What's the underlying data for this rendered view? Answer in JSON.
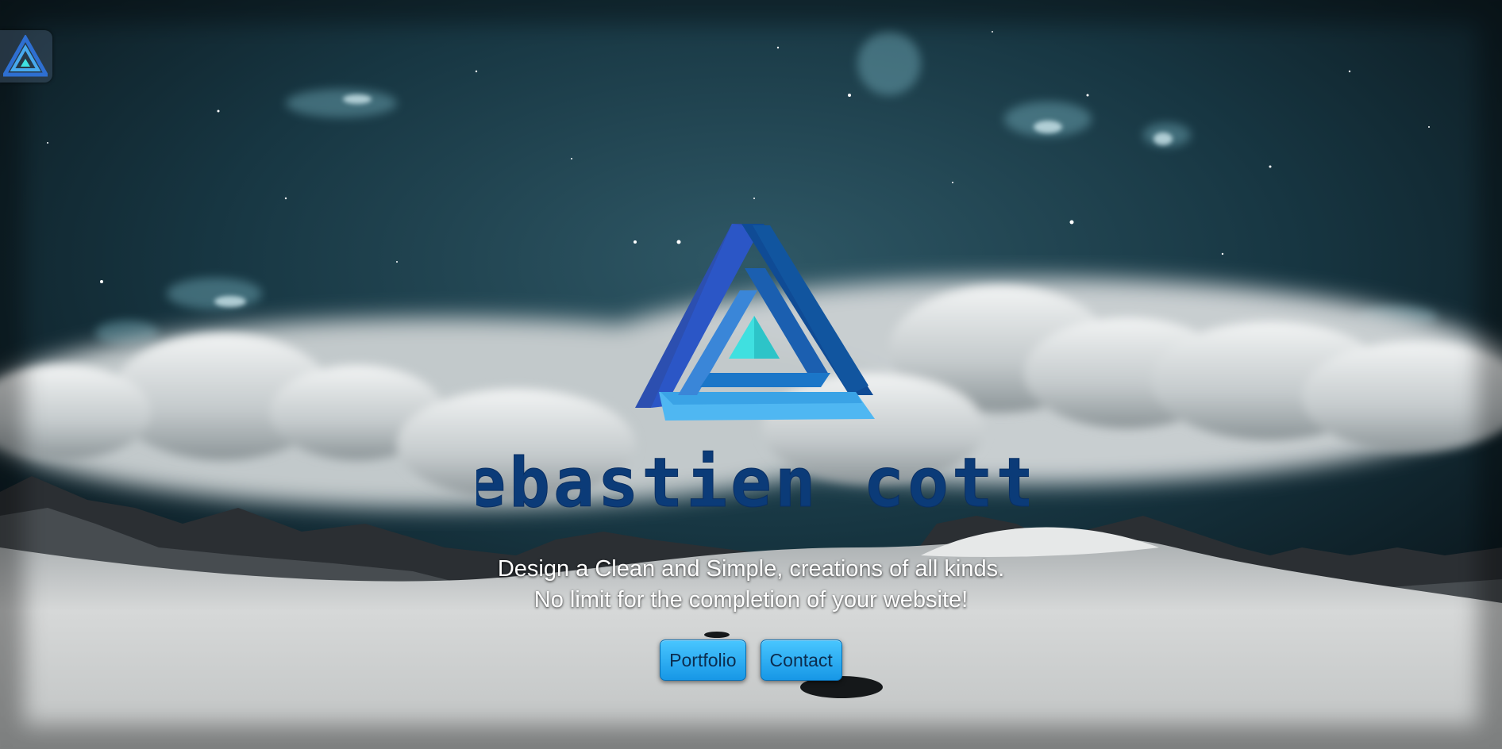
{
  "header": {
    "corner_logo_icon": "triangle-logo-icon"
  },
  "hero": {
    "logo_icon": "impossible-triangle-logo-icon",
    "wordmark": "sebastien cotta",
    "tagline_line1": "Design a Clean and Simple, creations of all kinds.",
    "tagline_line2": "No limit for the completion of your website!"
  },
  "nav": {
    "portfolio_label": "Portfolio",
    "contact_label": "Contact"
  },
  "colors": {
    "brand_dark_blue": "#0b3b78",
    "brand_blue": "#2e6fd1",
    "brand_light_blue": "#47a9ee",
    "brand_cyan": "#3fe0e0",
    "button_top": "#49c6ff",
    "button_bottom": "#1797e6",
    "text_white": "#ffffff"
  }
}
